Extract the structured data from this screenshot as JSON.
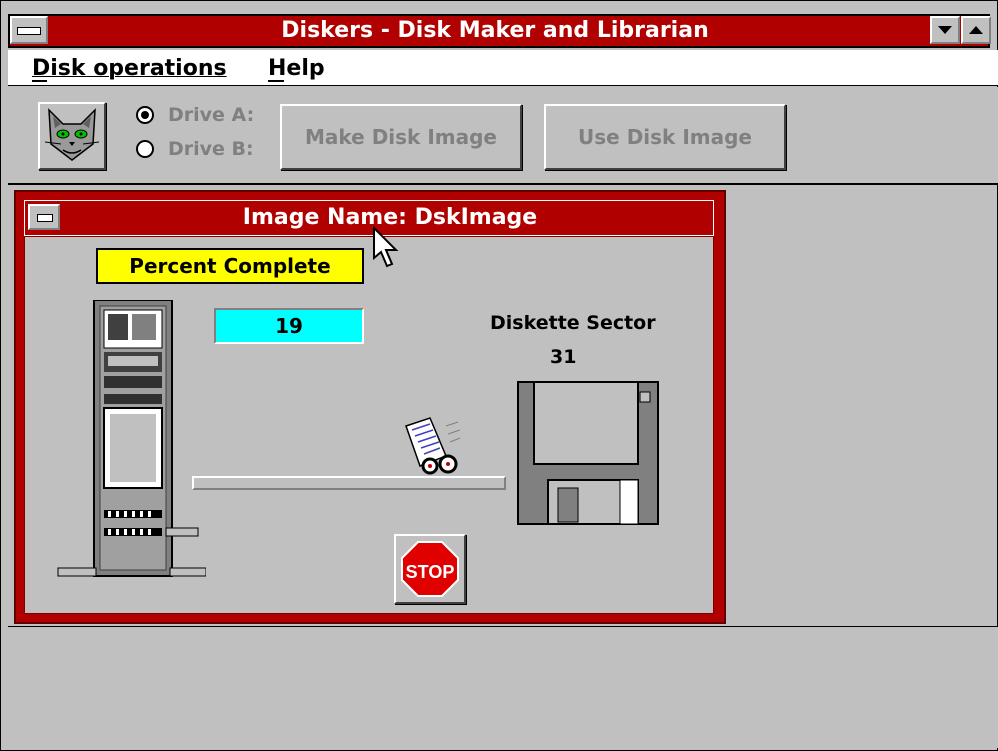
{
  "window": {
    "title": "Diskers - Disk Maker and Librarian"
  },
  "menu": {
    "items": [
      {
        "label": "Disk operations",
        "accel": "D"
      },
      {
        "label": "Help",
        "accel": "H"
      }
    ]
  },
  "toolbar": {
    "drive_a_label": "Drive A:",
    "drive_b_label": "Drive B:",
    "selected_drive": "A",
    "make_button": "Make Disk Image",
    "use_button": "Use Disk Image",
    "make_accel": "M",
    "use_accel": "U"
  },
  "child": {
    "title": "Image Name: DskImage",
    "percent_label": "Percent Complete",
    "percent_value": "19",
    "sector_label": "Diskette Sector",
    "sector_value": "31",
    "stop_label": "STOP"
  },
  "colors": {
    "title_bar": "#b00000",
    "percent_label_bg": "#ffff00",
    "percent_value_bg": "#00ffff",
    "stop_red": "#e00000"
  },
  "icons": {
    "app": "cat-icon",
    "computer": "tower-computer-icon",
    "transfer": "document-cart-icon",
    "floppy": "floppy-disk-icon",
    "stop": "stop-sign-icon",
    "cursor": "mouse-pointer-icon"
  }
}
